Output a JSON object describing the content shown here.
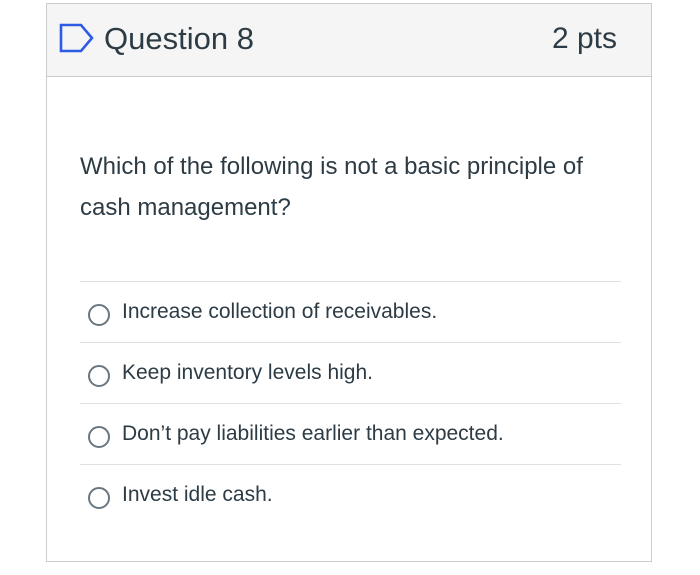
{
  "question": {
    "icon": "flag-outline-icon",
    "title": "Question 8",
    "points": "2 pts",
    "text": "Which of the following is not a basic principle of cash management?"
  },
  "answers": [
    {
      "label": "Increase collection of receivables.",
      "selected": false
    },
    {
      "label": "Keep inventory levels high.",
      "selected": false
    },
    {
      "label": "Don’t pay liabilities earlier than expected.",
      "selected": false
    },
    {
      "label": "Invest idle cash.",
      "selected": false
    }
  ],
  "colors": {
    "accent": "#2d5be3",
    "text": "#2d3b45",
    "header_bg": "#f5f5f5",
    "border": "#c7cdd1"
  }
}
